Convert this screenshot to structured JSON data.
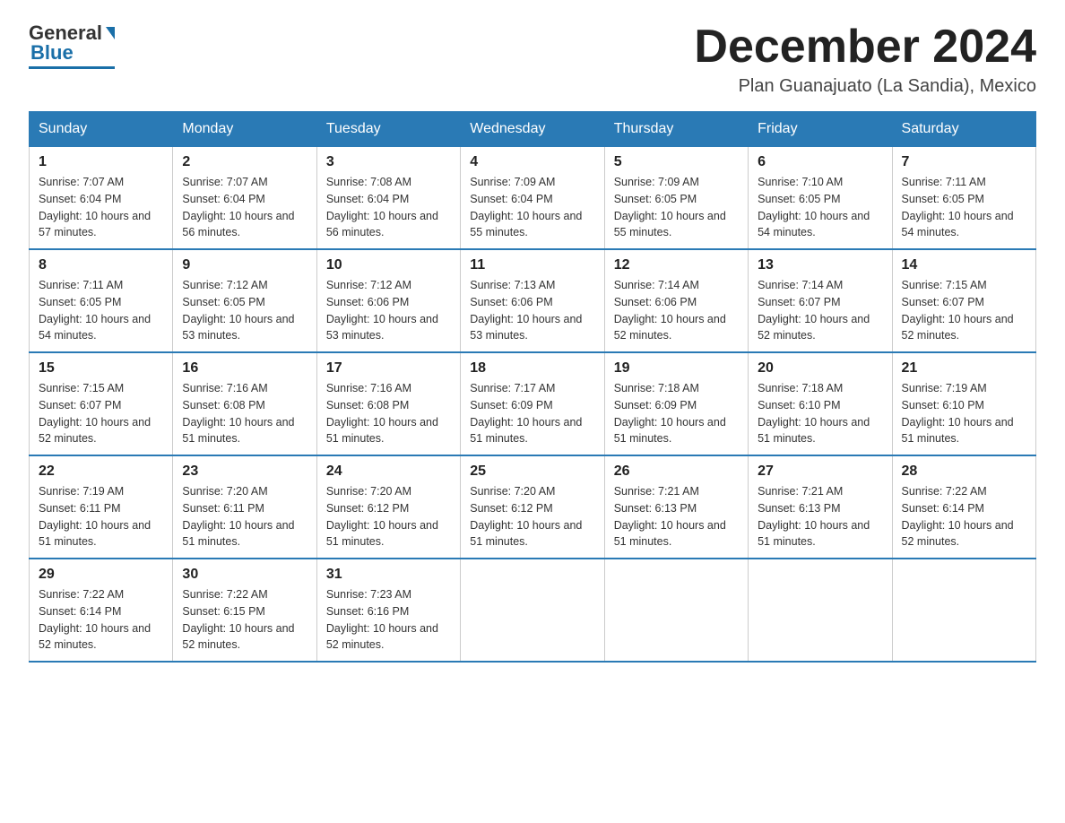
{
  "logo": {
    "general": "General",
    "blue": "Blue"
  },
  "header": {
    "month_year": "December 2024",
    "location": "Plan Guanajuato (La Sandia), Mexico"
  },
  "weekdays": [
    "Sunday",
    "Monday",
    "Tuesday",
    "Wednesday",
    "Thursday",
    "Friday",
    "Saturday"
  ],
  "weeks": [
    [
      {
        "day": "1",
        "sunrise": "7:07 AM",
        "sunset": "6:04 PM",
        "daylight": "10 hours and 57 minutes."
      },
      {
        "day": "2",
        "sunrise": "7:07 AM",
        "sunset": "6:04 PM",
        "daylight": "10 hours and 56 minutes."
      },
      {
        "day": "3",
        "sunrise": "7:08 AM",
        "sunset": "6:04 PM",
        "daylight": "10 hours and 56 minutes."
      },
      {
        "day": "4",
        "sunrise": "7:09 AM",
        "sunset": "6:04 PM",
        "daylight": "10 hours and 55 minutes."
      },
      {
        "day": "5",
        "sunrise": "7:09 AM",
        "sunset": "6:05 PM",
        "daylight": "10 hours and 55 minutes."
      },
      {
        "day": "6",
        "sunrise": "7:10 AM",
        "sunset": "6:05 PM",
        "daylight": "10 hours and 54 minutes."
      },
      {
        "day": "7",
        "sunrise": "7:11 AM",
        "sunset": "6:05 PM",
        "daylight": "10 hours and 54 minutes."
      }
    ],
    [
      {
        "day": "8",
        "sunrise": "7:11 AM",
        "sunset": "6:05 PM",
        "daylight": "10 hours and 54 minutes."
      },
      {
        "day": "9",
        "sunrise": "7:12 AM",
        "sunset": "6:05 PM",
        "daylight": "10 hours and 53 minutes."
      },
      {
        "day": "10",
        "sunrise": "7:12 AM",
        "sunset": "6:06 PM",
        "daylight": "10 hours and 53 minutes."
      },
      {
        "day": "11",
        "sunrise": "7:13 AM",
        "sunset": "6:06 PM",
        "daylight": "10 hours and 53 minutes."
      },
      {
        "day": "12",
        "sunrise": "7:14 AM",
        "sunset": "6:06 PM",
        "daylight": "10 hours and 52 minutes."
      },
      {
        "day": "13",
        "sunrise": "7:14 AM",
        "sunset": "6:07 PM",
        "daylight": "10 hours and 52 minutes."
      },
      {
        "day": "14",
        "sunrise": "7:15 AM",
        "sunset": "6:07 PM",
        "daylight": "10 hours and 52 minutes."
      }
    ],
    [
      {
        "day": "15",
        "sunrise": "7:15 AM",
        "sunset": "6:07 PM",
        "daylight": "10 hours and 52 minutes."
      },
      {
        "day": "16",
        "sunrise": "7:16 AM",
        "sunset": "6:08 PM",
        "daylight": "10 hours and 51 minutes."
      },
      {
        "day": "17",
        "sunrise": "7:16 AM",
        "sunset": "6:08 PM",
        "daylight": "10 hours and 51 minutes."
      },
      {
        "day": "18",
        "sunrise": "7:17 AM",
        "sunset": "6:09 PM",
        "daylight": "10 hours and 51 minutes."
      },
      {
        "day": "19",
        "sunrise": "7:18 AM",
        "sunset": "6:09 PM",
        "daylight": "10 hours and 51 minutes."
      },
      {
        "day": "20",
        "sunrise": "7:18 AM",
        "sunset": "6:10 PM",
        "daylight": "10 hours and 51 minutes."
      },
      {
        "day": "21",
        "sunrise": "7:19 AM",
        "sunset": "6:10 PM",
        "daylight": "10 hours and 51 minutes."
      }
    ],
    [
      {
        "day": "22",
        "sunrise": "7:19 AM",
        "sunset": "6:11 PM",
        "daylight": "10 hours and 51 minutes."
      },
      {
        "day": "23",
        "sunrise": "7:20 AM",
        "sunset": "6:11 PM",
        "daylight": "10 hours and 51 minutes."
      },
      {
        "day": "24",
        "sunrise": "7:20 AM",
        "sunset": "6:12 PM",
        "daylight": "10 hours and 51 minutes."
      },
      {
        "day": "25",
        "sunrise": "7:20 AM",
        "sunset": "6:12 PM",
        "daylight": "10 hours and 51 minutes."
      },
      {
        "day": "26",
        "sunrise": "7:21 AM",
        "sunset": "6:13 PM",
        "daylight": "10 hours and 51 minutes."
      },
      {
        "day": "27",
        "sunrise": "7:21 AM",
        "sunset": "6:13 PM",
        "daylight": "10 hours and 51 minutes."
      },
      {
        "day": "28",
        "sunrise": "7:22 AM",
        "sunset": "6:14 PM",
        "daylight": "10 hours and 52 minutes."
      }
    ],
    [
      {
        "day": "29",
        "sunrise": "7:22 AM",
        "sunset": "6:14 PM",
        "daylight": "10 hours and 52 minutes."
      },
      {
        "day": "30",
        "sunrise": "7:22 AM",
        "sunset": "6:15 PM",
        "daylight": "10 hours and 52 minutes."
      },
      {
        "day": "31",
        "sunrise": "7:23 AM",
        "sunset": "6:16 PM",
        "daylight": "10 hours and 52 minutes."
      },
      null,
      null,
      null,
      null
    ]
  ],
  "labels": {
    "sunrise": "Sunrise:",
    "sunset": "Sunset:",
    "daylight": "Daylight:"
  }
}
